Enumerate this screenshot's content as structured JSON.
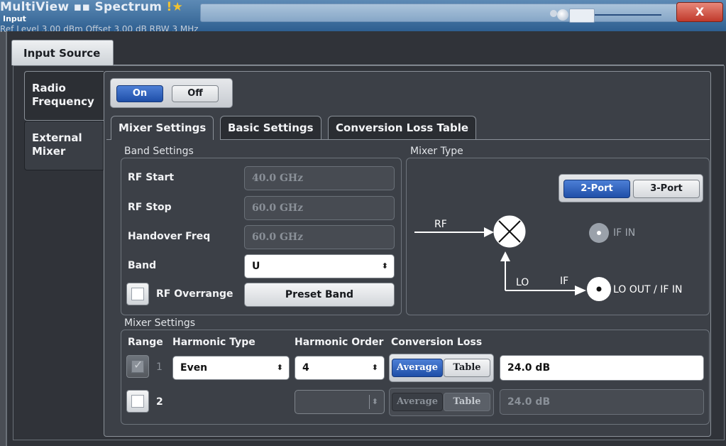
{
  "background": {
    "title_left": "MultiView",
    "title_right": "Spectrum",
    "overlay_label": "Input",
    "ref_line": "Ref Level 3.00 dBm   Offset 3.00 dB   RBW 3 MHz",
    "close_label": "X"
  },
  "dialog": {
    "source_tab": "Input Source",
    "side_tabs": [
      {
        "label_line1": "Radio",
        "label_line2": "Frequency"
      },
      {
        "label_line1": "External",
        "label_line2": "Mixer"
      }
    ],
    "toggle": {
      "on": "On",
      "off": "Off",
      "selected": "On"
    },
    "sub_tabs": [
      "Mixer Settings",
      "Basic Settings",
      "Conversion Loss Table"
    ],
    "band_settings": {
      "heading": "Band Settings",
      "rf_start": {
        "label": "RF Start",
        "value": "40.0 GHz"
      },
      "rf_stop": {
        "label": "RF Stop",
        "value": "60.0 GHz"
      },
      "handover": {
        "label": "Handover Freq",
        "value": "60.0 GHz"
      },
      "band": {
        "label": "Band",
        "value": "U"
      },
      "rf_overrange": {
        "label": "RF Overrange",
        "checked": false
      },
      "preset_band": "Preset Band"
    },
    "mixer_type": {
      "heading": "Mixer Type",
      "port_2": "2-Port",
      "port_3": "3-Port",
      "selected": "2-Port",
      "rf": "RF",
      "lo": "LO",
      "if": "IF",
      "if_in": "IF IN",
      "lo_out": "LO OUT / IF IN"
    },
    "mixer_settings": {
      "heading": "Mixer Settings",
      "col_range": "Range",
      "col_harmonic_type": "Harmonic Type",
      "col_harmonic_order": "Harmonic Order",
      "col_conversion_loss": "Conversion Loss",
      "rows": [
        {
          "index": "1",
          "checked": true,
          "harmonic_type": "Even",
          "harmonic_order": "4",
          "average": "Average",
          "table": "Table",
          "loss": "24.0 dB",
          "enabled": true
        },
        {
          "index": "2",
          "checked": false,
          "harmonic_type": "",
          "harmonic_order": "",
          "average": "Average",
          "table": "Table",
          "loss": "24.0 dB",
          "enabled": false
        }
      ]
    }
  }
}
